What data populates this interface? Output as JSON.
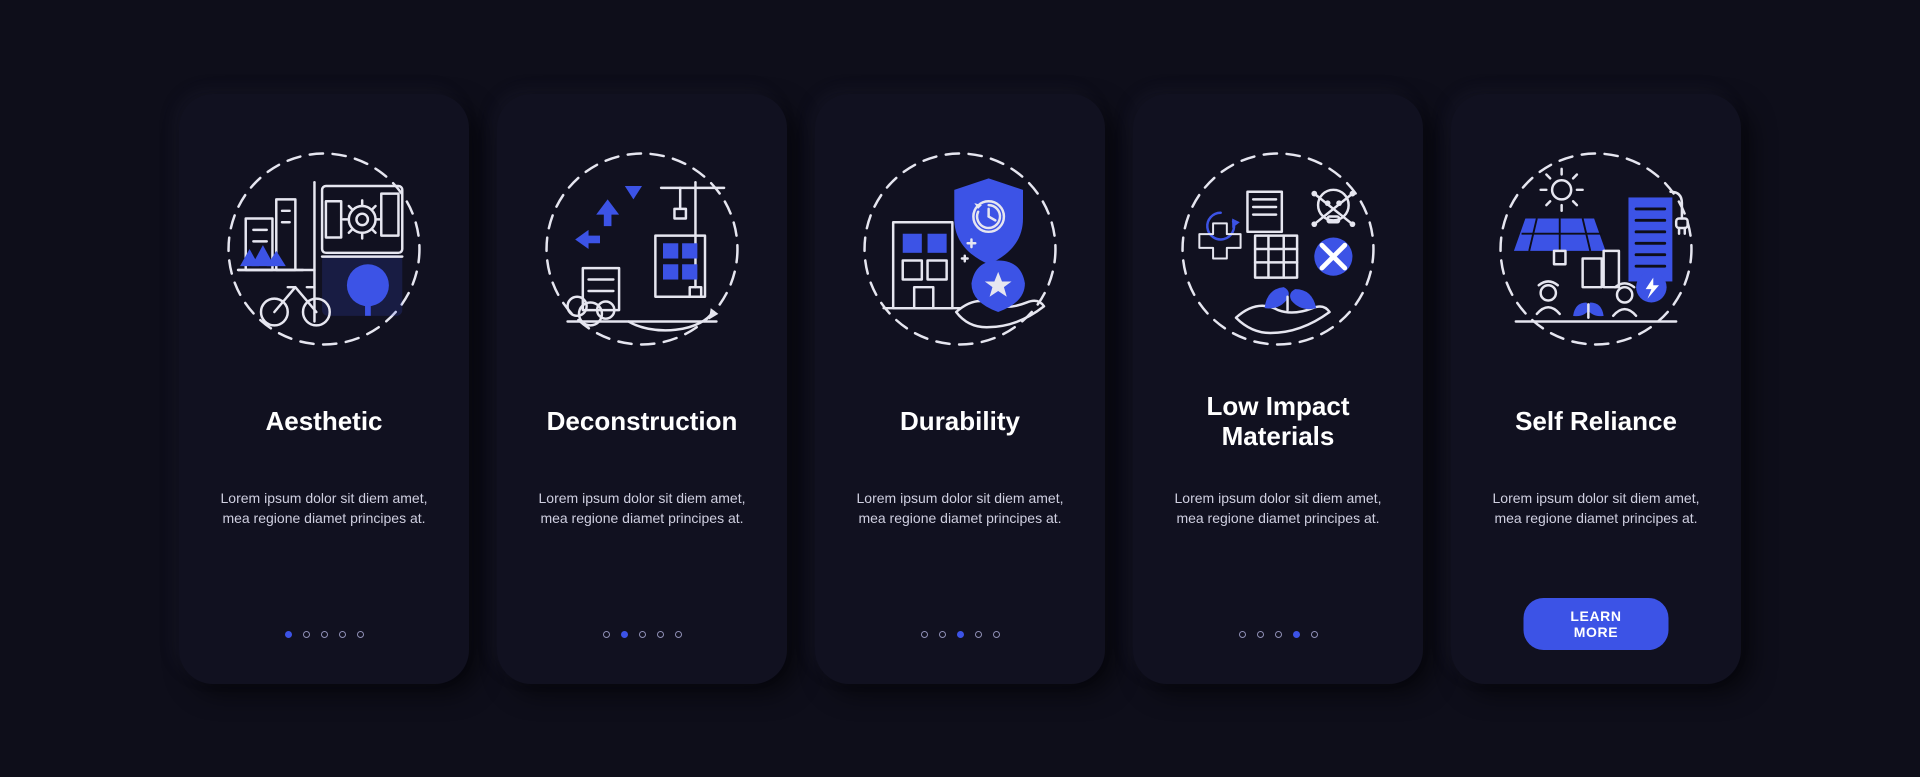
{
  "colors": {
    "accent": "#3c53e6",
    "card": "#111120",
    "bg": "#0e0e1a",
    "text": "#ffffff",
    "muted": "#cfcfe0"
  },
  "lorem": "Lorem ipsum dolor sit diem amet, mea regione diamet principes at.",
  "cta_label": "LEARN MORE",
  "cards": [
    {
      "title": "Aesthetic",
      "icon": "aesthetic-icon",
      "active_dot": 0,
      "has_cta": false
    },
    {
      "title": "Deconstruction",
      "icon": "deconstruction-icon",
      "active_dot": 1,
      "has_cta": false
    },
    {
      "title": "Durability",
      "icon": "durability-icon",
      "active_dot": 2,
      "has_cta": false
    },
    {
      "title": "Low Impact\nMaterials",
      "icon": "materials-icon",
      "active_dot": 3,
      "has_cta": false
    },
    {
      "title": "Self Reliance",
      "icon": "selfreliance-icon",
      "active_dot": 4,
      "has_cta": true
    }
  ]
}
